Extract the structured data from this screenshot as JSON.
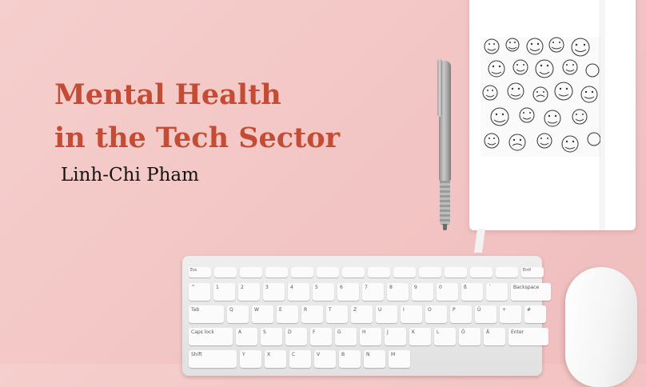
{
  "slide": {
    "title_line1": "Mental Health",
    "title_line2": "in the Tech Sector",
    "author": "Linh-Chi Pham"
  },
  "colors": {
    "background": "#f4cac9",
    "title": "#c44b34",
    "author": "#141414"
  },
  "keyboard": {
    "function_row": [
      "Esc",
      "",
      "",
      "",
      "",
      "",
      "",
      "",
      "",
      "",
      "",
      "",
      "",
      "Entf"
    ],
    "number_row": [
      "^",
      "1",
      "2",
      "3",
      "4",
      "5",
      "6",
      "7",
      "8",
      "9",
      "0",
      "ß",
      "´",
      "Backspace"
    ],
    "qwertz_row": [
      "Tab",
      "Q",
      "W",
      "E",
      "R",
      "T",
      "Z",
      "U",
      "I",
      "O",
      "P",
      "Ü",
      "+",
      "#"
    ],
    "home_row": [
      "Caps lock",
      "A",
      "S",
      "D",
      "F",
      "G",
      "H",
      "J",
      "K",
      "L",
      "Ö",
      "Ä",
      "Enter"
    ],
    "bottom_row": [
      "Shift",
      "Y",
      "X",
      "C",
      "V",
      "B",
      "N",
      "M"
    ]
  }
}
